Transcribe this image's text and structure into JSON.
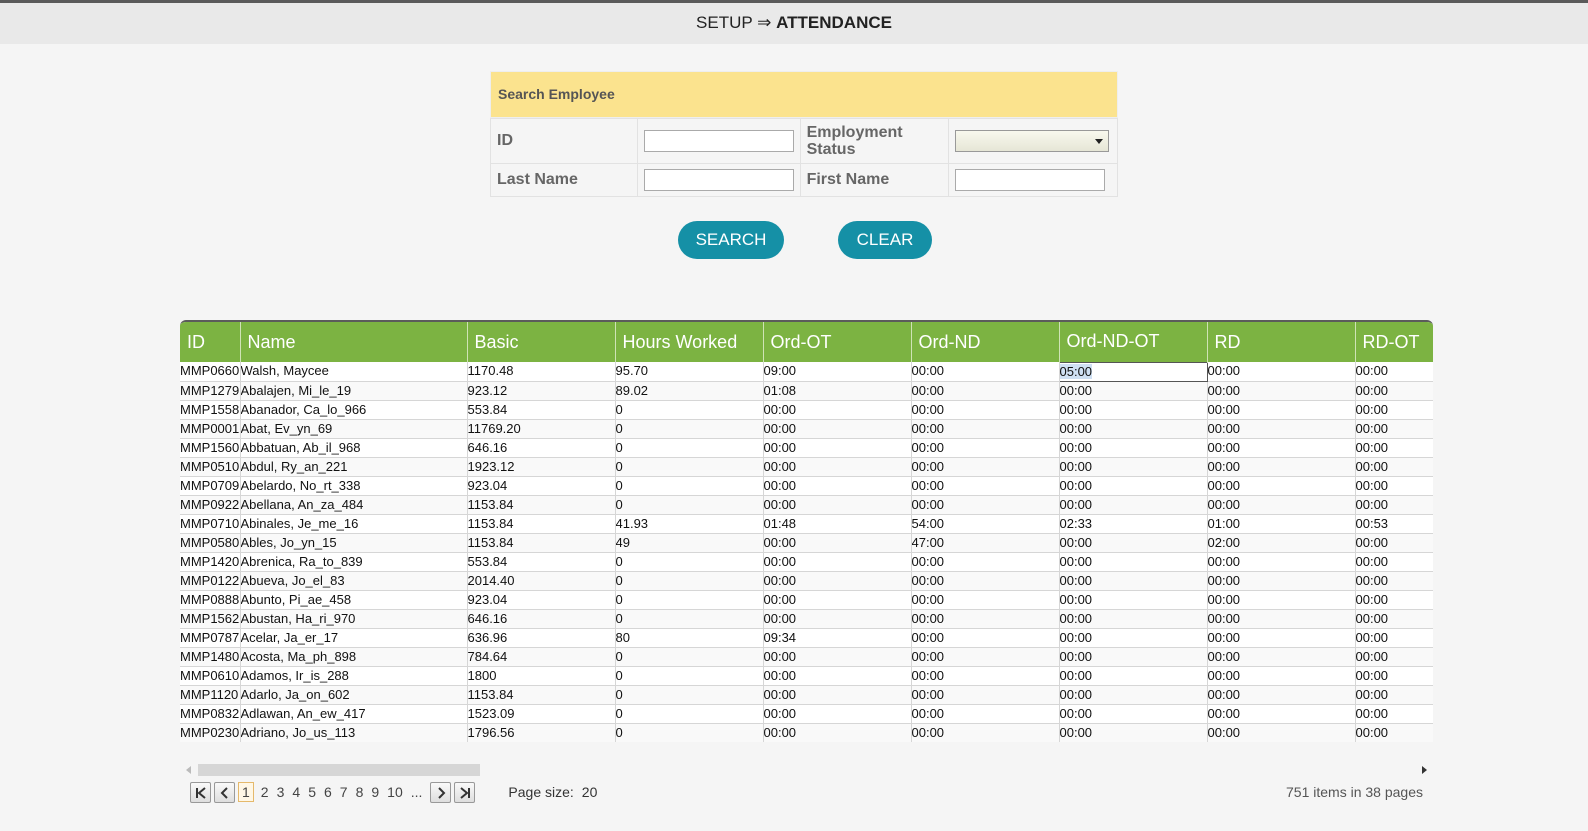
{
  "header": {
    "prefix": "SETUP ⇒",
    "title": "ATTENDANCE"
  },
  "search": {
    "title": "Search Employee",
    "id_label": "ID",
    "employment_status_label": "Employment Status",
    "last_name_label": "Last Name",
    "first_name_label": "First Name",
    "id_value": "",
    "last_name_value": "",
    "first_name_value": "",
    "employment_status_value": "",
    "search_label": "SEARCH",
    "clear_label": "CLEAR"
  },
  "grid": {
    "columns": [
      "ID",
      "Name",
      "Basic",
      "Hours Worked",
      "Ord-OT",
      "Ord-ND",
      "Ord-ND-OT",
      "RD",
      "RD-OT"
    ],
    "rows": [
      [
        "MMP0660",
        "Walsh, Maycee",
        "1170.48",
        "95.70",
        "09:00",
        "00:00",
        "05:00",
        "00:00",
        "00:00"
      ],
      [
        "MMP1279",
        "Abalajen, Mi_le_19",
        "923.12",
        "89.02",
        "01:08",
        "00:00",
        "00:00",
        "00:00",
        "00:00"
      ],
      [
        "MMP1558",
        "Abanador, Ca_lo_966",
        "553.84",
        "0",
        "00:00",
        "00:00",
        "00:00",
        "00:00",
        "00:00"
      ],
      [
        "MMP0001",
        "Abat, Ev_yn_69",
        "11769.20",
        "0",
        "00:00",
        "00:00",
        "00:00",
        "00:00",
        "00:00"
      ],
      [
        "MMP1560",
        "Abbatuan, Ab_il_968",
        "646.16",
        "0",
        "00:00",
        "00:00",
        "00:00",
        "00:00",
        "00:00"
      ],
      [
        "MMP0510",
        "Abdul, Ry_an_221",
        "1923.12",
        "0",
        "00:00",
        "00:00",
        "00:00",
        "00:00",
        "00:00"
      ],
      [
        "MMP0709",
        "Abelardo, No_rt_338",
        "923.04",
        "0",
        "00:00",
        "00:00",
        "00:00",
        "00:00",
        "00:00"
      ],
      [
        "MMP0922",
        "Abellana, An_za_484",
        "1153.84",
        "0",
        "00:00",
        "00:00",
        "00:00",
        "00:00",
        "00:00"
      ],
      [
        "MMP0710",
        "Abinales, Je_me_16",
        "1153.84",
        "41.93",
        "01:48",
        "54:00",
        "02:33",
        "01:00",
        "00:53"
      ],
      [
        "MMP0580",
        "Ables, Jo_yn_15",
        "1153.84",
        "49",
        "00:00",
        "47:00",
        "00:00",
        "02:00",
        "00:00"
      ],
      [
        "MMP1420",
        "Abrenica, Ra_to_839",
        "553.84",
        "0",
        "00:00",
        "00:00",
        "00:00",
        "00:00",
        "00:00"
      ],
      [
        "MMP0122",
        "Abueva, Jo_el_83",
        "2014.40",
        "0",
        "00:00",
        "00:00",
        "00:00",
        "00:00",
        "00:00"
      ],
      [
        "MMP0888",
        "Abunto, Pi_ae_458",
        "923.04",
        "0",
        "00:00",
        "00:00",
        "00:00",
        "00:00",
        "00:00"
      ],
      [
        "MMP1562",
        "Abustan, Ha_ri_970",
        "646.16",
        "0",
        "00:00",
        "00:00",
        "00:00",
        "00:00",
        "00:00"
      ],
      [
        "MMP0787",
        "Acelar, Ja_er_17",
        "636.96",
        "80",
        "09:34",
        "00:00",
        "00:00",
        "00:00",
        "00:00"
      ],
      [
        "MMP1480",
        "Acosta, Ma_ph_898",
        "784.64",
        "0",
        "00:00",
        "00:00",
        "00:00",
        "00:00",
        "00:00"
      ],
      [
        "MMP0610",
        "Adamos, Ir_is_288",
        "1800",
        "0",
        "00:00",
        "00:00",
        "00:00",
        "00:00",
        "00:00"
      ],
      [
        "MMP1120",
        "Adarlo, Ja_on_602",
        "1153.84",
        "0",
        "00:00",
        "00:00",
        "00:00",
        "00:00",
        "00:00"
      ],
      [
        "MMP0832",
        "Adlawan, An_ew_417",
        "1523.09",
        "0",
        "00:00",
        "00:00",
        "00:00",
        "00:00",
        "00:00"
      ],
      [
        "MMP0230",
        "Adriano, Jo_us_113",
        "1796.56",
        "0",
        "00:00",
        "00:00",
        "00:00",
        "00:00",
        "00:00"
      ]
    ],
    "editing_cell": {
      "row": 0,
      "col": 6
    }
  },
  "pager": {
    "pages": [
      "1",
      "2",
      "3",
      "4",
      "5",
      "6",
      "7",
      "8",
      "9",
      "10",
      "..."
    ],
    "current_page": "1",
    "page_size_label": "Page size:",
    "page_size": "20",
    "summary": "751 items in 38 pages"
  },
  "colors": {
    "header_green": "#7cb342",
    "button_teal": "#1590a6",
    "panel_yellow": "#fbe38e"
  }
}
